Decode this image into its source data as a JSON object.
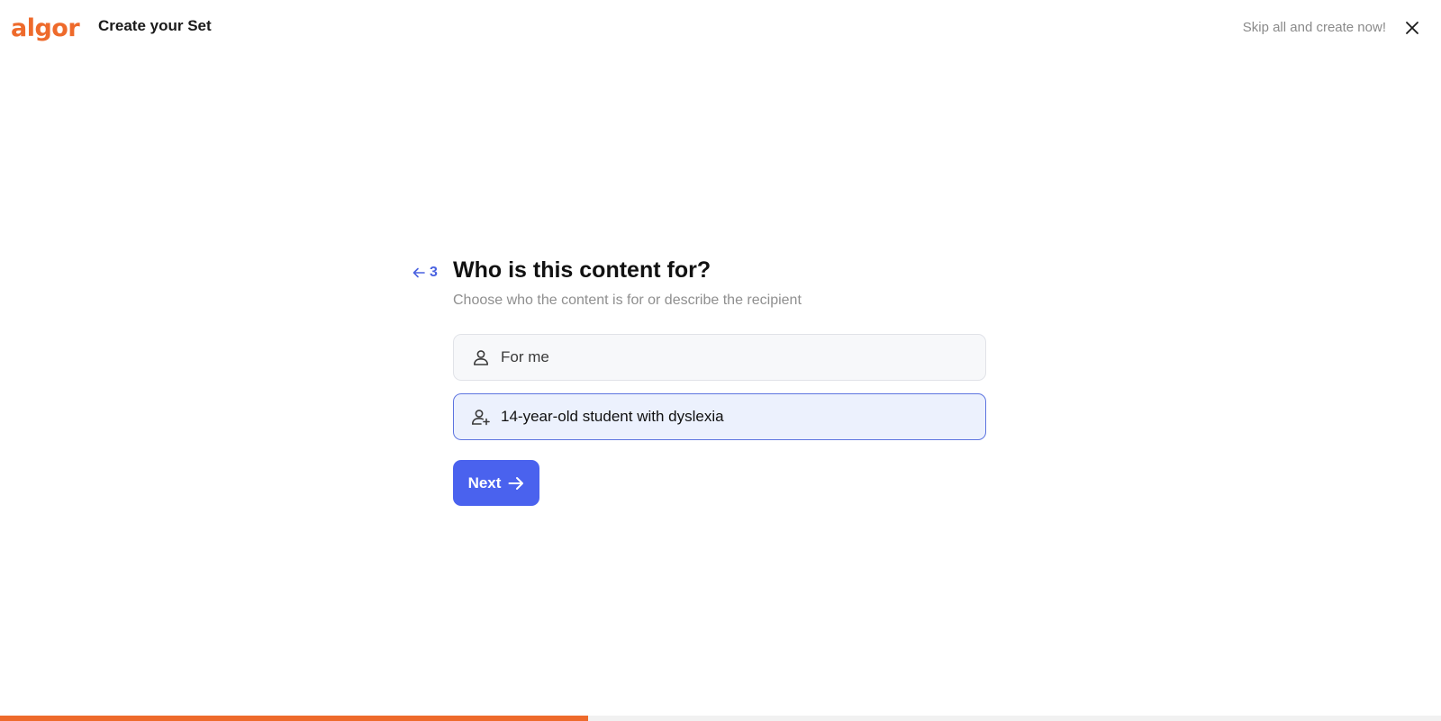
{
  "colors": {
    "brand": "#ee6a2b",
    "accent": "#4a62e0",
    "accent_button": "#4a62ee"
  },
  "header": {
    "logo_text": "algor",
    "title": "Create your Set",
    "skip_label": "Skip all and create now!",
    "close_icon": "close-icon"
  },
  "question": {
    "step_number": "3",
    "back_icon": "arrow-left-icon",
    "title": "Who is this content for?",
    "subtitle": "Choose who the content is for or describe the recipient"
  },
  "options": [
    {
      "label": "For me",
      "icon": "user-icon",
      "selected": false
    },
    {
      "label": "14-year-old student with dyslexia",
      "icon": "user-plus-icon",
      "selected": true
    }
  ],
  "next_button": {
    "label": "Next",
    "icon": "arrow-right-icon"
  },
  "progress": {
    "fraction": 0.408
  }
}
